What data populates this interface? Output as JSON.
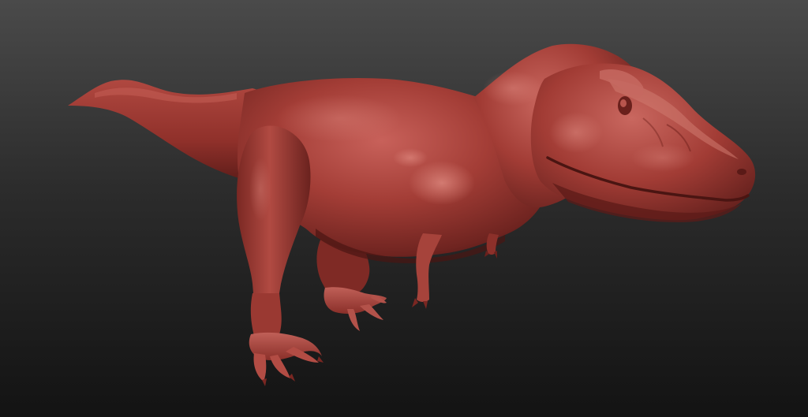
{
  "scene": {
    "subject": "t-rex-sculpt",
    "colors": {
      "background_top": "#4a4a4a",
      "background_mid": "#2a2a2a",
      "background_bottom": "#141414",
      "clay_base": "#a33d36",
      "clay_highlight": "#d2746a",
      "clay_shadow": "#5e1d1a",
      "clay_deep_shadow": "#3f1211"
    }
  }
}
